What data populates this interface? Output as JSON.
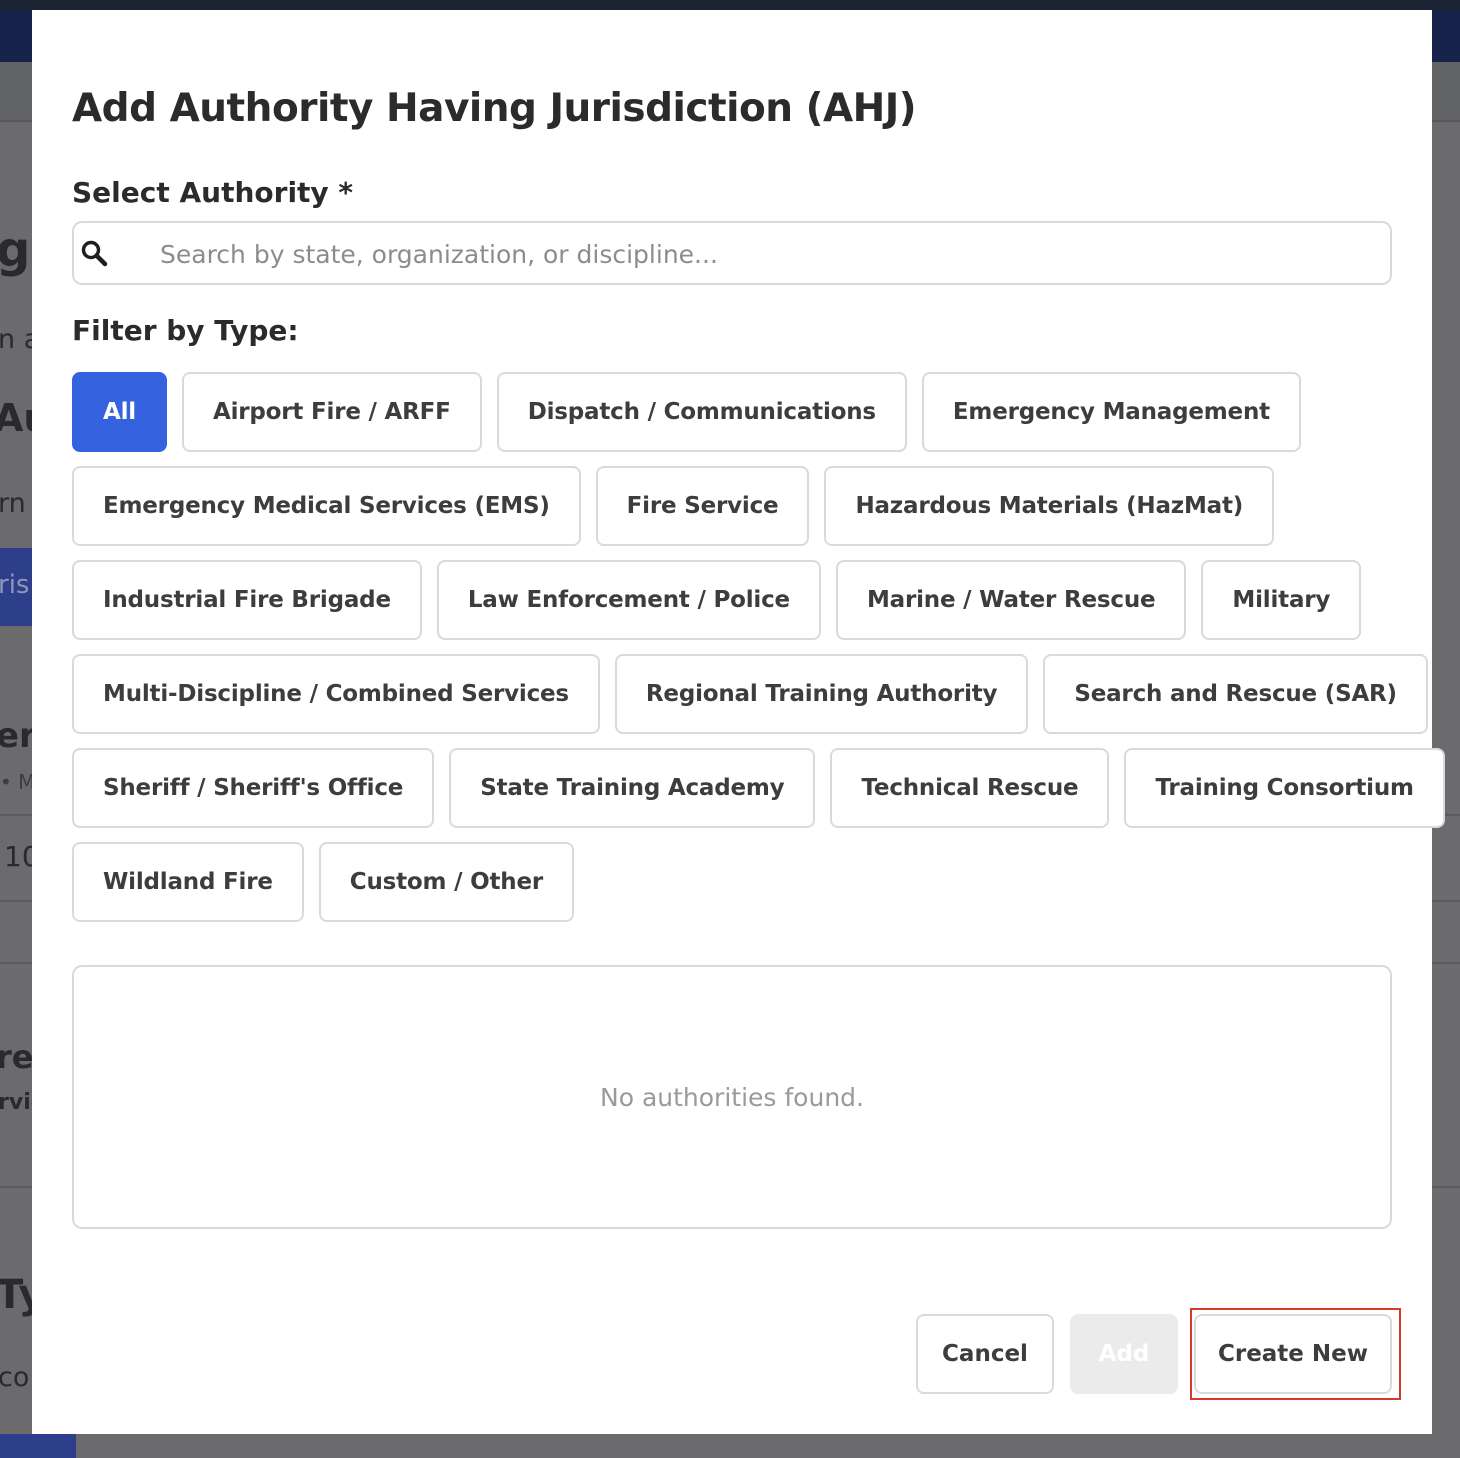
{
  "modal": {
    "title": "Add Authority Having Jurisdiction (AHJ)",
    "select_label": "Select Authority *",
    "search": {
      "placeholder": "Search by state, organization, or discipline...",
      "value": ""
    },
    "filter_label": "Filter by Type:",
    "filter_rows": [
      [
        "All",
        "Airport Fire / ARFF",
        "Dispatch / Communications",
        "Emergency Management"
      ],
      [
        "Emergency Medical Services (EMS)",
        "Fire Service",
        "Hazardous Materials (HazMat)"
      ],
      [
        "Industrial Fire Brigade",
        "Law Enforcement / Police",
        "Marine / Water Rescue",
        "Military"
      ],
      [
        "Multi-Discipline / Combined Services",
        "Regional Training Authority",
        "Search and Rescue (SAR)"
      ],
      [
        "Sheriff / Sheriff's Office",
        "State Training Academy",
        "Technical Rescue",
        "Training Consortium"
      ],
      [
        "Wildland Fire",
        "Custom / Other"
      ]
    ],
    "active_filter": "All",
    "empty_message": "No authorities found.",
    "buttons": {
      "cancel": "Cancel",
      "add": "Add",
      "create_new": "Create New"
    }
  },
  "background": {
    "fragments": [
      "gu",
      "n a",
      "Au",
      "rn y",
      "ris",
      "erv",
      "•  M",
      "10",
      "rea",
      "rvic",
      "Ty",
      "co"
    ]
  },
  "colors": {
    "accent": "#3563e0",
    "highlight": "#d63b2a",
    "header_bg": "#17234b"
  }
}
